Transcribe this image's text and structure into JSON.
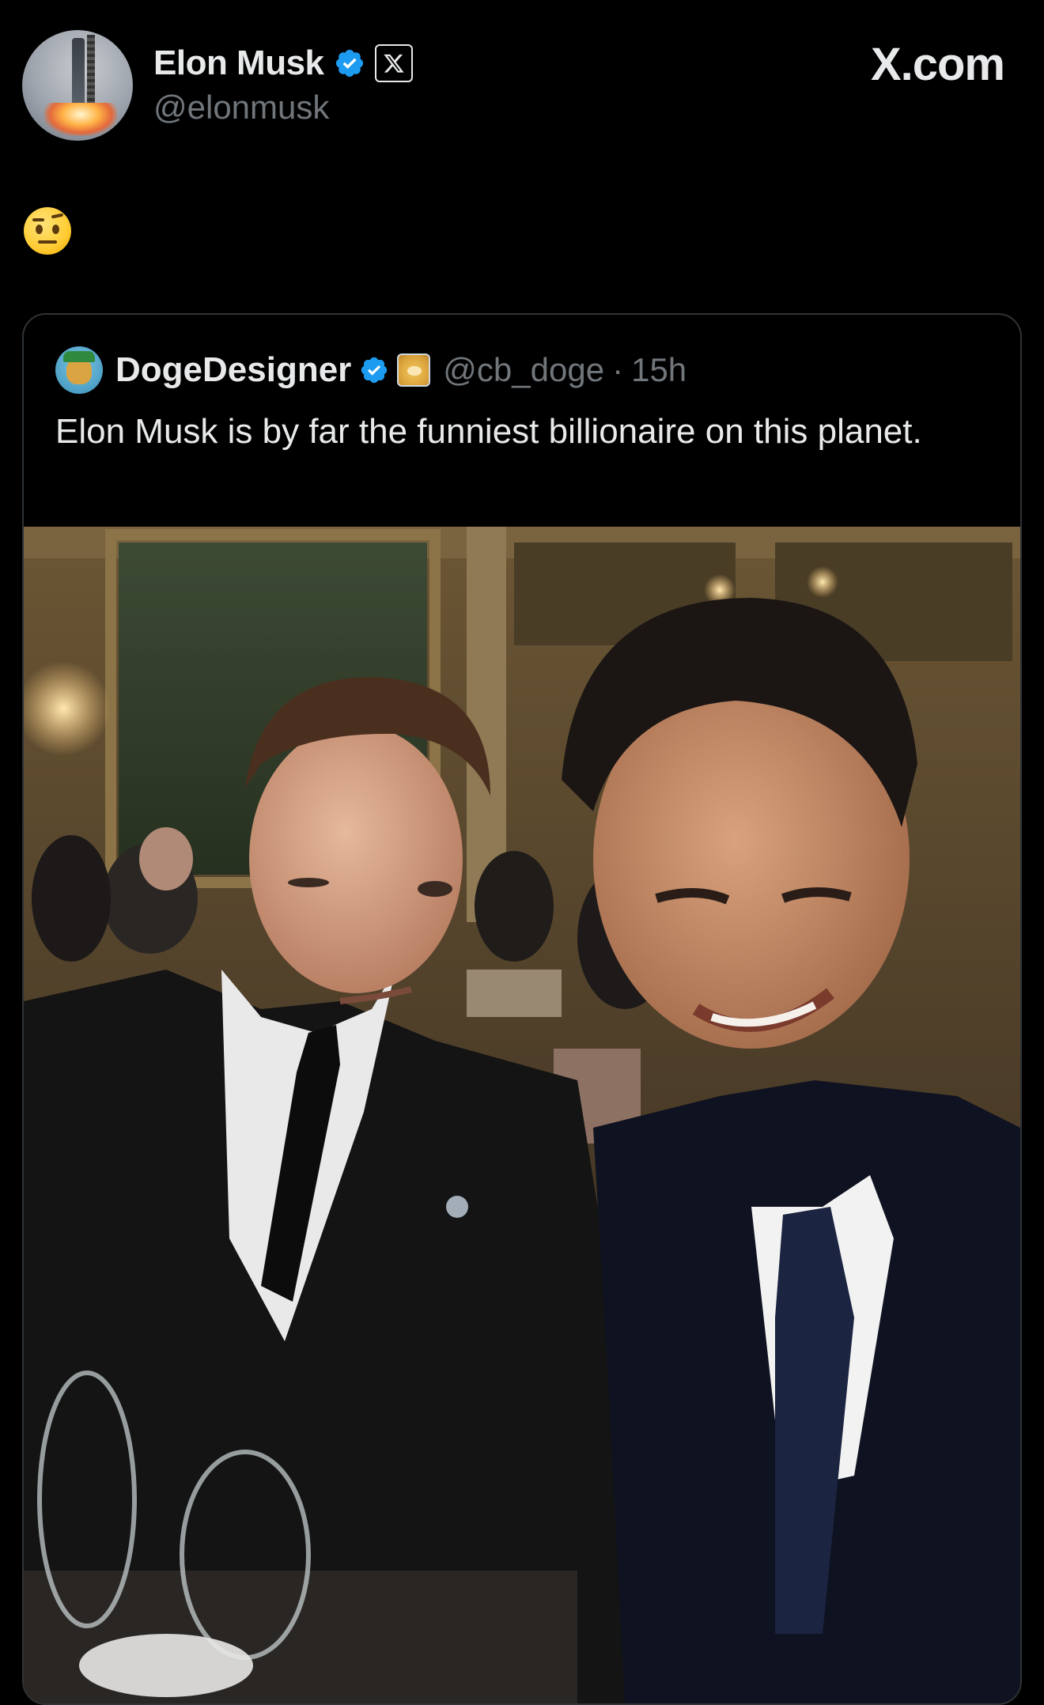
{
  "header": {
    "author_name": "Elon Musk",
    "author_handle": "@elonmusk",
    "brand": "X.com",
    "avatar_icon": "rocket-launch-avatar",
    "verified_color": "#1d9bf0"
  },
  "post": {
    "emoji_icon": "face-with-raised-eyebrow-emoji"
  },
  "quoted_post": {
    "author_name": "DogeDesigner",
    "author_handle": "@cb_doge",
    "separator": "·",
    "time": "15h",
    "text": "Elon Musk is by far the funniest billionaire on this planet.",
    "image_description_icon": "dinner-selfie-photo"
  },
  "colors": {
    "background": "#000000",
    "text_primary": "#e7e9ea",
    "text_secondary": "#71767b",
    "border": "#2f3336",
    "verified": "#1d9bf0"
  }
}
